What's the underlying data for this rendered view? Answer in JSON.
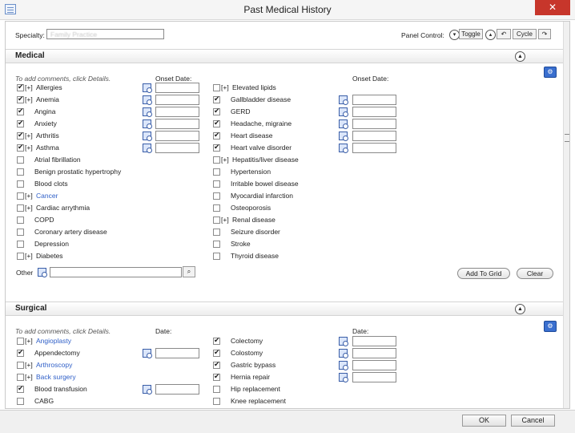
{
  "window": {
    "title": "Past Medical History",
    "close_label": "✕"
  },
  "spec": {
    "label": "Specialty:",
    "value": "Family Practice",
    "panel_control_label": "Panel Control:",
    "toggle_label": "Toggle",
    "cycle_label": "Cycle"
  },
  "medical": {
    "title": "Medical",
    "hint": "To add comments, click Details.",
    "onset_left": "Onset Date:",
    "onset_right": "Onset Date:",
    "left": [
      {
        "label": "Allergies",
        "prefix": "[+]",
        "checked": true,
        "link": false,
        "details": true
      },
      {
        "label": "Anemia",
        "prefix": "[+]",
        "checked": true,
        "link": false,
        "details": true
      },
      {
        "label": "Angina",
        "prefix": "",
        "checked": true,
        "link": false,
        "details": true
      },
      {
        "label": "Anxiety",
        "prefix": "",
        "checked": true,
        "link": false,
        "details": true
      },
      {
        "label": "Arthritis",
        "prefix": "[+]",
        "checked": true,
        "link": false,
        "details": true
      },
      {
        "label": "Asthma",
        "prefix": "[+]",
        "checked": true,
        "link": false,
        "details": true
      },
      {
        "label": "Atrial fibrillation",
        "prefix": "",
        "checked": false,
        "link": false,
        "details": false
      },
      {
        "label": "Benign prostatic hypertrophy",
        "prefix": "",
        "checked": false,
        "link": false,
        "details": false
      },
      {
        "label": "Blood clots",
        "prefix": "",
        "checked": false,
        "link": false,
        "details": false
      },
      {
        "label": "Cancer",
        "prefix": "[+]",
        "checked": false,
        "link": true,
        "details": false
      },
      {
        "label": "Cardiac arrythmia",
        "prefix": "[+]",
        "checked": false,
        "link": false,
        "details": false
      },
      {
        "label": "COPD",
        "prefix": "",
        "checked": false,
        "link": false,
        "details": false
      },
      {
        "label": "Coronary artery disease",
        "prefix": "",
        "checked": false,
        "link": false,
        "details": false
      },
      {
        "label": "Depression",
        "prefix": "",
        "checked": false,
        "link": false,
        "details": false
      },
      {
        "label": "Diabetes",
        "prefix": "[+]",
        "checked": false,
        "link": false,
        "details": false
      }
    ],
    "right": [
      {
        "label": "Elevated lipids",
        "prefix": "[+]",
        "checked": false,
        "link": false,
        "details": false
      },
      {
        "label": "Gallbladder disease",
        "prefix": "",
        "checked": true,
        "link": false,
        "details": true
      },
      {
        "label": "GERD",
        "prefix": "",
        "checked": true,
        "link": false,
        "details": true
      },
      {
        "label": "Headache, migraine",
        "prefix": "",
        "checked": true,
        "link": false,
        "details": true
      },
      {
        "label": "Heart disease",
        "prefix": "",
        "checked": true,
        "link": false,
        "details": true
      },
      {
        "label": "Heart valve disorder",
        "prefix": "",
        "checked": true,
        "link": false,
        "details": true
      },
      {
        "label": "Hepatitis/liver disease",
        "prefix": "[+]",
        "checked": false,
        "link": false,
        "details": false
      },
      {
        "label": "Hypertension",
        "prefix": "",
        "checked": false,
        "link": false,
        "details": false
      },
      {
        "label": "Irritable bowel disease",
        "prefix": "",
        "checked": false,
        "link": false,
        "details": false
      },
      {
        "label": "Myocardial infarction",
        "prefix": "",
        "checked": false,
        "link": false,
        "details": false
      },
      {
        "label": "Osteoporosis",
        "prefix": "",
        "checked": false,
        "link": false,
        "details": false
      },
      {
        "label": "Renal disease",
        "prefix": "[+]",
        "checked": false,
        "link": false,
        "details": false
      },
      {
        "label": "Seizure disorder",
        "prefix": "",
        "checked": false,
        "link": false,
        "details": false
      },
      {
        "label": "Stroke",
        "prefix": "",
        "checked": false,
        "link": false,
        "details": false
      },
      {
        "label": "Thyroid disease",
        "prefix": "",
        "checked": false,
        "link": false,
        "details": false
      }
    ],
    "other_label": "Other",
    "add_to_grid": "Add To Grid",
    "clear": "Clear"
  },
  "surgical": {
    "title": "Surgical",
    "hint": "To add comments, click Details.",
    "date_left": "Date:",
    "date_right": "Date:",
    "left": [
      {
        "label": "Angioplasty",
        "prefix": "[+]",
        "checked": false,
        "link": true,
        "details": false
      },
      {
        "label": "Appendectomy",
        "prefix": "",
        "checked": true,
        "link": false,
        "details": true
      },
      {
        "label": "Arthroscopy",
        "prefix": "[+]",
        "checked": false,
        "link": true,
        "details": false
      },
      {
        "label": "Back surgery",
        "prefix": "[+]",
        "checked": false,
        "link": true,
        "details": false
      },
      {
        "label": "Blood transfusion",
        "prefix": "",
        "checked": true,
        "link": false,
        "details": true
      },
      {
        "label": "CABG",
        "prefix": "",
        "checked": false,
        "link": false,
        "details": false
      }
    ],
    "right": [
      {
        "label": "Colectomy",
        "prefix": "",
        "checked": true,
        "link": false,
        "details": true
      },
      {
        "label": "Colostomy",
        "prefix": "",
        "checked": true,
        "link": false,
        "details": true
      },
      {
        "label": "Gastric bypass",
        "prefix": "",
        "checked": true,
        "link": false,
        "details": true
      },
      {
        "label": "Hernia repair",
        "prefix": "",
        "checked": true,
        "link": false,
        "details": true
      },
      {
        "label": "Hip replacement",
        "prefix": "",
        "checked": false,
        "link": false,
        "details": false
      },
      {
        "label": "Knee replacement",
        "prefix": "",
        "checked": false,
        "link": false,
        "details": false
      }
    ]
  },
  "footer": {
    "ok": "OK",
    "cancel": "Cancel"
  }
}
